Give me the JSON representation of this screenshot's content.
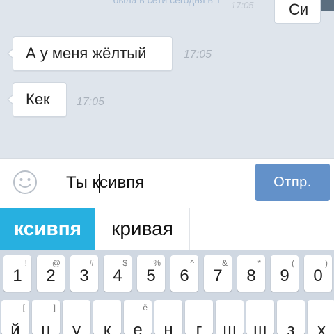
{
  "chat": {
    "top_notice": "была в сети сегодня в 1",
    "top_time": "17:05",
    "top_bubble_text": "Си",
    "messages": [
      {
        "text": "А у меня жёлтый",
        "time": "17:05"
      },
      {
        "text": "Кек",
        "time": "17:05"
      }
    ]
  },
  "composer": {
    "text_before_caret": "Ты к",
    "text_after_caret": "сивпя",
    "send_label": "Отпр.",
    "emoji_icon": "smiley-icon"
  },
  "suggestions": {
    "active": "ксивпя",
    "items": [
      "кривая"
    ]
  },
  "keyboard": {
    "row1": [
      {
        "key": "1",
        "alt": "!"
      },
      {
        "key": "2",
        "alt": "@"
      },
      {
        "key": "3",
        "alt": "#"
      },
      {
        "key": "4",
        "alt": "$"
      },
      {
        "key": "5",
        "alt": "%"
      },
      {
        "key": "6",
        "alt": "^"
      },
      {
        "key": "7",
        "alt": "&"
      },
      {
        "key": "8",
        "alt": "*"
      },
      {
        "key": "9",
        "alt": "("
      },
      {
        "key": "0",
        "alt": ")"
      }
    ],
    "row2": [
      {
        "key": "й",
        "alt": "["
      },
      {
        "key": "ц",
        "alt": "]"
      },
      {
        "key": "у",
        "alt": ""
      },
      {
        "key": "к",
        "alt": ""
      },
      {
        "key": "е",
        "alt": "ё"
      },
      {
        "key": "н",
        "alt": ""
      },
      {
        "key": "г",
        "alt": ""
      },
      {
        "key": "ш",
        "alt": ""
      },
      {
        "key": "щ",
        "alt": ""
      },
      {
        "key": "з",
        "alt": ""
      },
      {
        "key": "х",
        "alt": ""
      }
    ]
  },
  "colors": {
    "accent": "#27b0e0",
    "send_button": "#6391c9"
  }
}
